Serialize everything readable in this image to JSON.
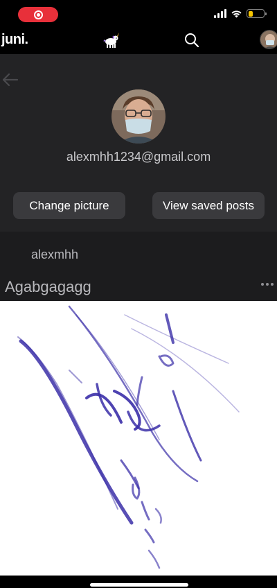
{
  "status_bar": {
    "recording_icon": "screen-recording-icon",
    "battery_color": "#f5c400",
    "battery_level": 0.3
  },
  "nav": {
    "brand": "juni.",
    "logo_icon": "unicorn-icon",
    "search_icon": "search-icon"
  },
  "profile": {
    "back_icon": "arrow-left-icon",
    "email": "alexmhh1234@gmail.com",
    "change_picture_label": "Change picture",
    "view_saved_label": "View saved posts"
  },
  "post": {
    "username": "alexmhh",
    "title": "Agabgagagg",
    "more_icon": "more-horizontal-icon"
  },
  "colors": {
    "panel_bg": "#232325",
    "button_bg": "#3a3a3d",
    "recording_red": "#e8303a",
    "ink": "#3b2fa8"
  }
}
